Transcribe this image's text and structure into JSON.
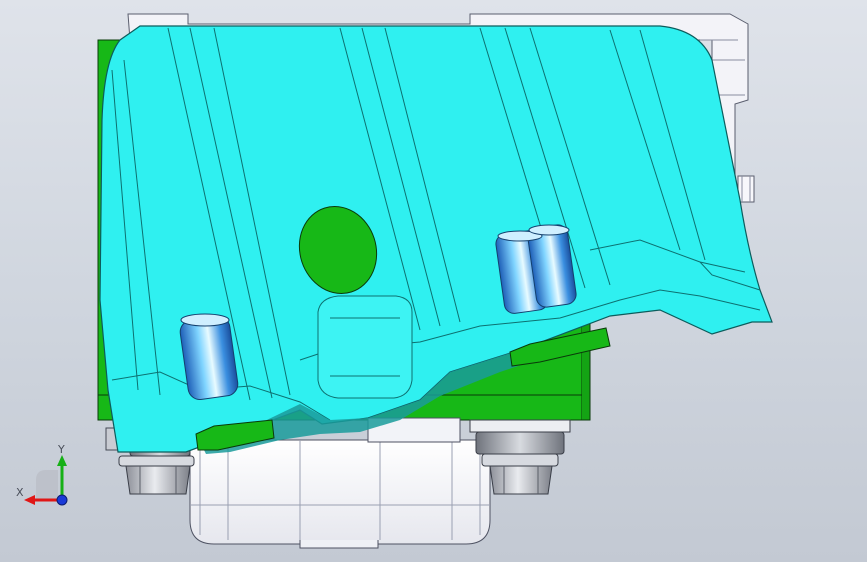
{
  "viewport": {
    "background_top": "#dfe3ea",
    "background_bottom": "#c3c9d3"
  },
  "colors": {
    "cover_cyan": "#2ff0f0",
    "cover_edge": "#0c5c5c",
    "block_green": "#17b817",
    "block_edge": "#0a3a0a",
    "housing_white": "#f4f4f8",
    "fastener_grey": "#b9bcc4",
    "pin_blue": "#3a8fe0",
    "axis_x": "#e01616",
    "axis_y": "#16b016",
    "axis_z": "#1a3ad8"
  },
  "triad": {
    "x_label": "X",
    "y_label": "Y"
  },
  "model": {
    "parts": [
      {
        "name": "top-cover",
        "icon": "sheet-metal-cover-icon"
      },
      {
        "name": "base-block",
        "icon": "block-icon"
      },
      {
        "name": "lower-housing",
        "icon": "housing-icon"
      },
      {
        "name": "left-nut",
        "icon": "hex-nut-icon"
      },
      {
        "name": "right-nut",
        "icon": "hex-nut-icon"
      },
      {
        "name": "left-pin",
        "icon": "dowel-pin-icon"
      },
      {
        "name": "right-pin-pair",
        "icon": "dowel-pin-icon"
      }
    ]
  }
}
